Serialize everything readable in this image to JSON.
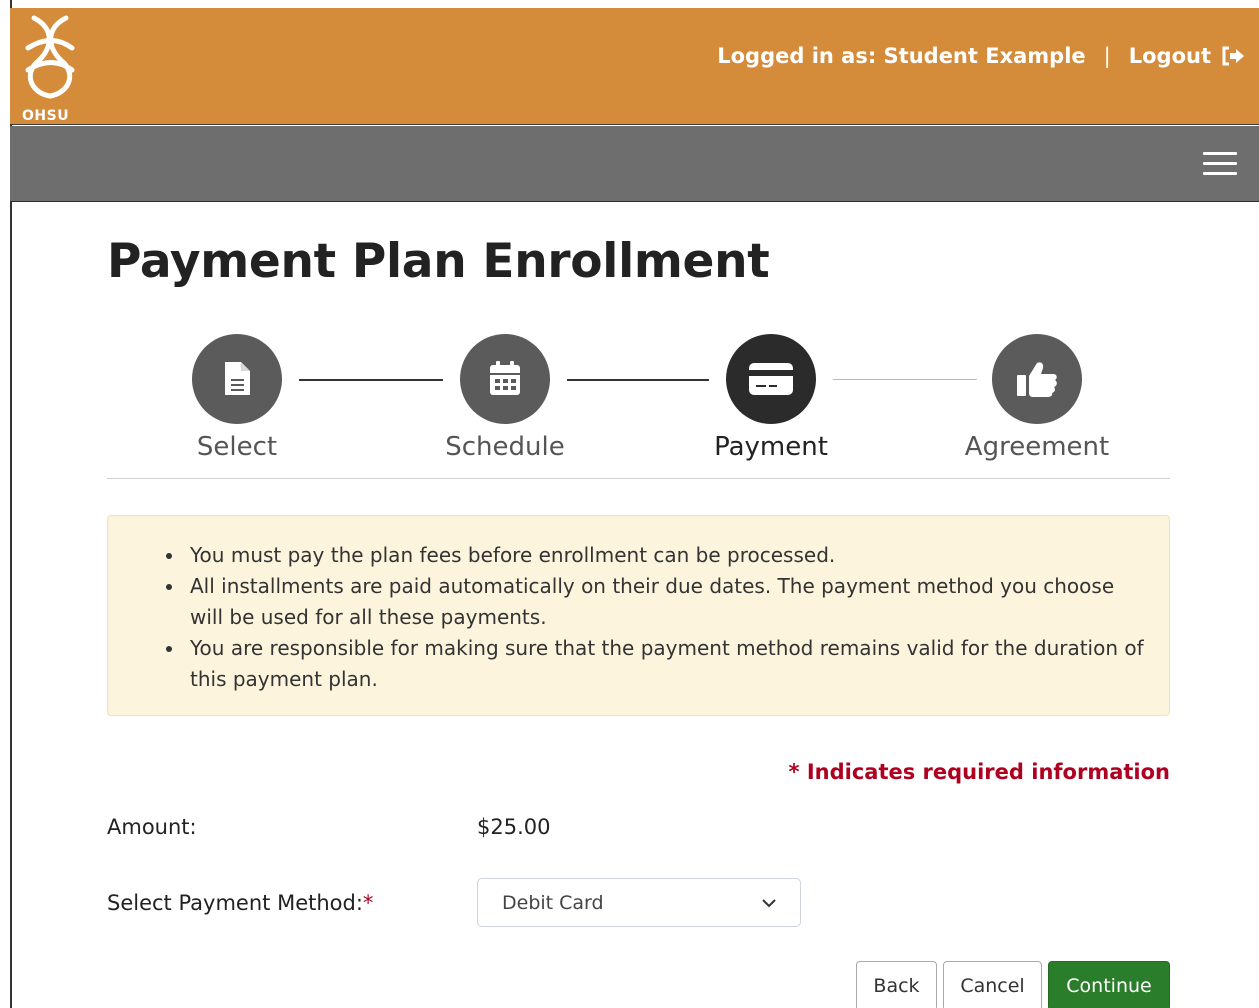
{
  "header": {
    "logo_text": "OHSU",
    "logged_in_label": "Logged in as: Student Example",
    "separator": "|",
    "logout_label": "Logout"
  },
  "page": {
    "title": "Payment Plan Enrollment"
  },
  "stepper": {
    "steps": [
      {
        "label": "Select",
        "icon": "document-icon"
      },
      {
        "label": "Schedule",
        "icon": "calendar-icon"
      },
      {
        "label": "Payment",
        "icon": "credit-card-icon"
      },
      {
        "label": "Agreement",
        "icon": "thumbs-up-icon"
      }
    ],
    "active_step": "Payment"
  },
  "notice": {
    "items": [
      "You must pay the plan fees before enrollment can be processed.",
      "All installments are paid automatically on their due dates. The payment method you choose will be used for all these payments.",
      "You are responsible for making sure that the payment method remains valid for the duration of this payment plan."
    ]
  },
  "form": {
    "required_note": "* Indicates required information",
    "amount_label": "Amount:",
    "amount_value": "$25.00",
    "payment_method_label": "Select Payment Method:",
    "required_marker": "*",
    "payment_method_value": "Debit Card"
  },
  "buttons": {
    "back": "Back",
    "cancel": "Cancel",
    "continue": "Continue"
  },
  "colors": {
    "header_bg": "#d48c3b",
    "nav_bg": "#6e6e6e",
    "required": "#b00020",
    "primary": "#2a7d2a",
    "alert_bg": "#fcf4dd"
  }
}
